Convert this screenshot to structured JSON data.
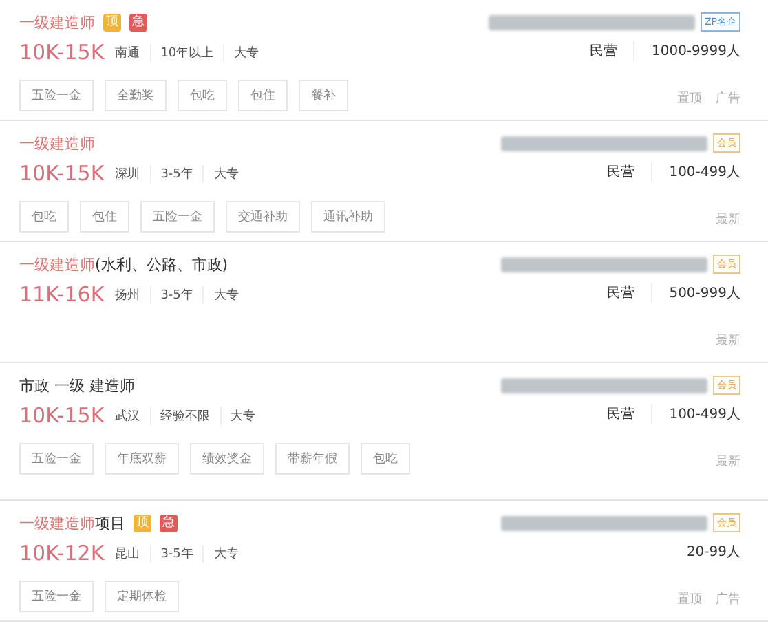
{
  "jobs": [
    {
      "title_parts": [
        {
          "text": "一级建造师",
          "highlight": true
        }
      ],
      "badges": [
        {
          "text": "顶",
          "kind": "top"
        },
        {
          "text": "急",
          "kind": "urgent"
        }
      ],
      "salary": "10K-15K",
      "meta": [
        "南通",
        "10年以上",
        "大专"
      ],
      "tags": [
        "五险一金",
        "全勤奖",
        "包吃",
        "包住",
        "餐补"
      ],
      "company_badge": {
        "text": "ZP名企",
        "kind": "famous"
      },
      "company_info": [
        "民营",
        "1000-9999人"
      ],
      "flags": [
        "置顶",
        "广告"
      ]
    },
    {
      "title_parts": [
        {
          "text": "一级建造师",
          "highlight": true
        }
      ],
      "salary": "10K-15K",
      "meta": [
        "深圳",
        "3-5年",
        "大专"
      ],
      "tags": [
        "包吃",
        "包住",
        "五险一金",
        "交通补助",
        "通讯补助"
      ],
      "company_badge": {
        "text": "会员",
        "kind": "member"
      },
      "company_info": [
        "民营",
        "100-499人"
      ],
      "flags": [
        "最新"
      ]
    },
    {
      "title_parts": [
        {
          "text": "一级建造师",
          "highlight": true
        },
        {
          "text": "(水利、公路、市政)",
          "highlight": false
        }
      ],
      "salary": "11K-16K",
      "meta": [
        "扬州",
        "3-5年",
        "大专"
      ],
      "company_badge": {
        "text": "会员",
        "kind": "member"
      },
      "company_info": [
        "民营",
        "500-999人"
      ],
      "flags": [
        "最新"
      ]
    },
    {
      "title_parts": [
        {
          "text": "市政 一级 建造师",
          "highlight": false
        }
      ],
      "salary": "10K-15K",
      "meta": [
        "武汉",
        "经验不限",
        "大专"
      ],
      "tags": [
        "五险一金",
        "年底双薪",
        "绩效奖金",
        "带薪年假",
        "包吃"
      ],
      "company_badge": {
        "text": "会员",
        "kind": "member"
      },
      "company_info": [
        "民营",
        "100-499人"
      ],
      "flags": [
        "最新"
      ]
    },
    {
      "title_parts": [
        {
          "text": "一级建造师",
          "highlight": true
        },
        {
          "text": "项目",
          "highlight": false
        }
      ],
      "badges": [
        {
          "text": "顶",
          "kind": "top"
        },
        {
          "text": "急",
          "kind": "urgent"
        }
      ],
      "salary": "10K-12K",
      "meta": [
        "昆山",
        "3-5年",
        "大专"
      ],
      "tags": [
        "五险一金",
        "定期体检"
      ],
      "company_badge": {
        "text": "会员",
        "kind": "member"
      },
      "company_info": [
        "20-99人"
      ],
      "flags": [
        "置顶",
        "广告"
      ]
    }
  ]
}
